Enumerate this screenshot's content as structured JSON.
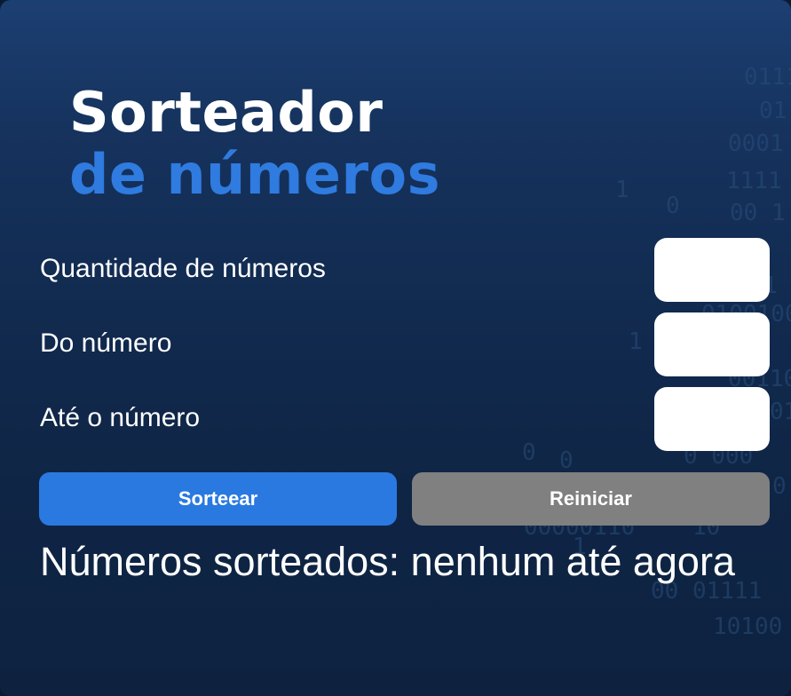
{
  "title": {
    "line1": "Sorteador",
    "line2": "de números"
  },
  "form": {
    "quantity_label": "Quantidade de números",
    "from_label": "Do número",
    "to_label": "Até o número",
    "quantity_value": "",
    "from_value": "",
    "to_value": ""
  },
  "buttons": {
    "draw_label": "Sorteear",
    "reset_label": "Reiniciar"
  },
  "result": {
    "text": "Números sorteados: nenhum até agora"
  },
  "colors": {
    "accent": "#2a79e1",
    "disabled": "#808080",
    "background": "#0f2545"
  }
}
